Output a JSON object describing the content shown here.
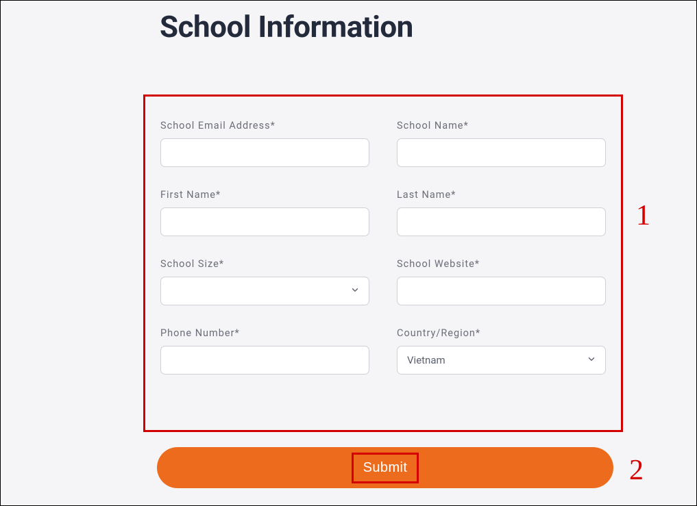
{
  "heading": "School Information",
  "fields": {
    "school_email": {
      "label": "School Email Address*",
      "value": ""
    },
    "school_name": {
      "label": "School Name*",
      "value": ""
    },
    "first_name": {
      "label": "First Name*",
      "value": ""
    },
    "last_name": {
      "label": "Last Name*",
      "value": ""
    },
    "school_size": {
      "label": "School Size*",
      "value": ""
    },
    "school_website": {
      "label": "School Website*",
      "value": ""
    },
    "phone_number": {
      "label": "Phone Number*",
      "value": ""
    },
    "country_region": {
      "label": "Country/Region*",
      "value": "Vietnam"
    }
  },
  "submit_label": "Submit",
  "annotations": {
    "form_marker": "1",
    "submit_marker": "2"
  }
}
